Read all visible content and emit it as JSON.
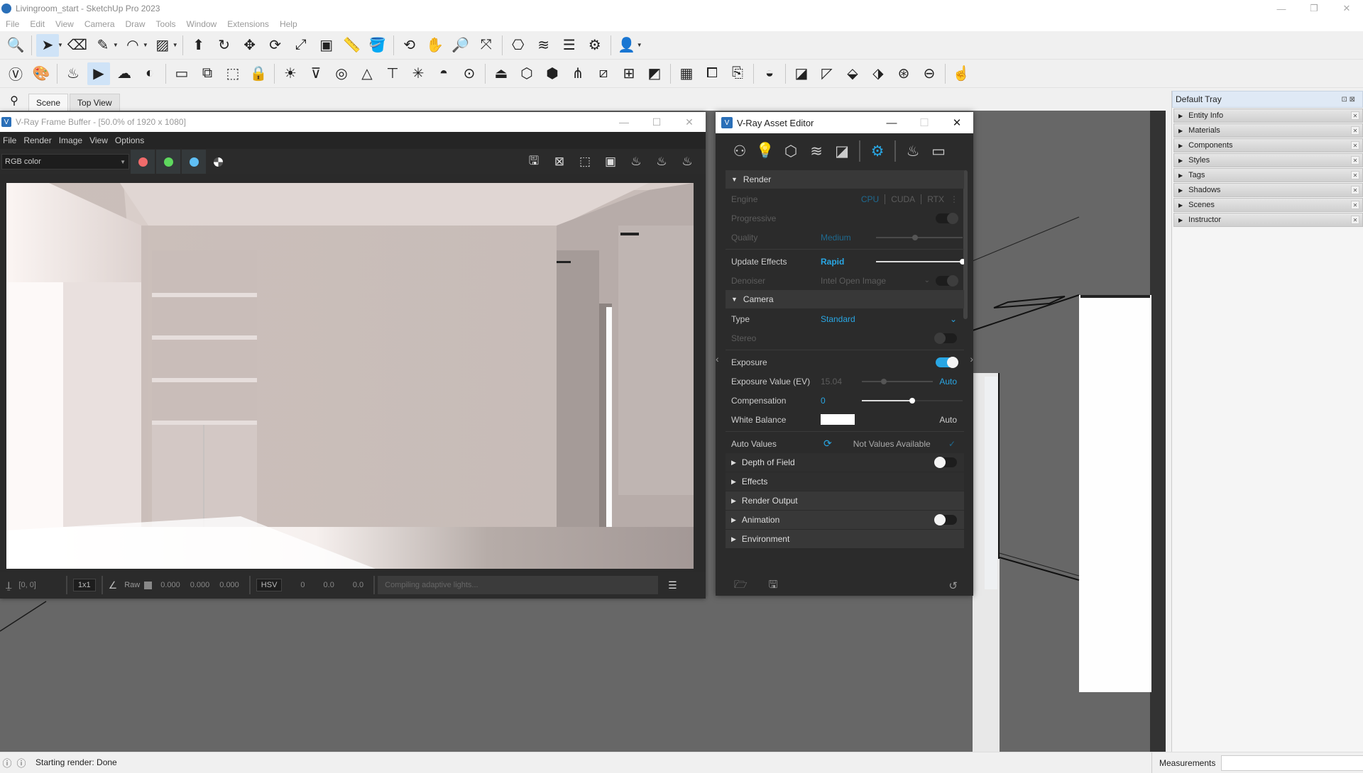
{
  "app": {
    "title": "Livingroom_start - SketchUp Pro 2023",
    "window_controls": [
      "—",
      "❐",
      "✕"
    ]
  },
  "menubar": [
    "File",
    "Edit",
    "View",
    "Camera",
    "Draw",
    "Tools",
    "Window",
    "Extensions",
    "Help"
  ],
  "toolbar1": [
    {
      "icon": "zoom-icon",
      "glyph": "🔍"
    },
    {
      "icon": "select-icon",
      "glyph": "➤",
      "selected": true,
      "dropdown": true
    },
    {
      "icon": "eraser-icon",
      "glyph": "⌫"
    },
    {
      "icon": "pencil-icon",
      "glyph": "✎",
      "dropdown": true
    },
    {
      "icon": "arc-icon",
      "glyph": "◠",
      "dropdown": true
    },
    {
      "icon": "rectangle-icon",
      "glyph": "▨",
      "dropdown": true
    },
    {
      "icon": "push-pull-icon",
      "glyph": "⬆"
    },
    {
      "icon": "follow-me-icon",
      "glyph": "↻"
    },
    {
      "icon": "move-icon",
      "glyph": "✥"
    },
    {
      "icon": "rotate-icon",
      "glyph": "⟳"
    },
    {
      "icon": "scale-icon",
      "glyph": "⤢"
    },
    {
      "icon": "offset-icon",
      "glyph": "▣"
    },
    {
      "icon": "tape-measure-icon",
      "glyph": "📏"
    },
    {
      "icon": "paint-bucket-icon",
      "glyph": "🪣"
    },
    {
      "icon": "orbit-icon",
      "glyph": "⟲"
    },
    {
      "icon": "pan-icon",
      "glyph": "✋"
    },
    {
      "icon": "zoom-window-icon",
      "glyph": "🔎"
    },
    {
      "icon": "zoom-extents-icon",
      "glyph": "⤧"
    },
    {
      "icon": "warehouse-icon",
      "glyph": "⎔"
    },
    {
      "icon": "extension-warehouse-icon",
      "glyph": "≋"
    },
    {
      "icon": "layout-icon",
      "glyph": "☰"
    },
    {
      "icon": "extension-manager-icon",
      "glyph": "⚙"
    },
    {
      "icon": "account-icon",
      "glyph": "👤",
      "dropdown": true
    }
  ],
  "toolbar2": [
    {
      "icon": "vray-logo-icon",
      "glyph": "Ⓥ"
    },
    {
      "icon": "asset-editor-icon",
      "glyph": "🎨"
    },
    {
      "icon": "render-icon",
      "glyph": "♨"
    },
    {
      "icon": "interactive-render-icon",
      "glyph": "▶",
      "selected": true
    },
    {
      "icon": "cloud-render-icon",
      "glyph": "☁"
    },
    {
      "icon": "vision-icon",
      "glyph": "◐"
    },
    {
      "icon": "frame-buffer-icon",
      "glyph": "▭"
    },
    {
      "icon": "lightmix-icon",
      "glyph": "⧉"
    },
    {
      "icon": "render-region-icon",
      "glyph": "⬚"
    },
    {
      "icon": "lock-camera-icon",
      "glyph": "🔒"
    },
    {
      "icon": "sun-light-icon",
      "glyph": "☀"
    },
    {
      "icon": "rect-light-icon",
      "glyph": "⊽"
    },
    {
      "icon": "sphere-light-icon",
      "glyph": "◎"
    },
    {
      "icon": "spot-light-icon",
      "glyph": "△"
    },
    {
      "icon": "ies-light-icon",
      "glyph": "⊤"
    },
    {
      "icon": "omni-light-icon",
      "glyph": "✳"
    },
    {
      "icon": "dome-light-icon",
      "glyph": "◓"
    },
    {
      "icon": "mesh-light-icon",
      "glyph": "⊙"
    },
    {
      "icon": "infinite-plane-icon",
      "glyph": "⏏"
    },
    {
      "icon": "export-proxy-icon",
      "glyph": "⬡"
    },
    {
      "icon": "import-proxy-icon",
      "glyph": "⬢"
    },
    {
      "icon": "fur-icon",
      "glyph": "⋔"
    },
    {
      "icon": "clipper-icon",
      "glyph": "⧄"
    },
    {
      "icon": "mesh-clipper-icon",
      "glyph": "⊞"
    },
    {
      "icon": "decal-icon",
      "glyph": "◩"
    },
    {
      "icon": "scatter-icon",
      "glyph": "▦"
    },
    {
      "icon": "chaos-cosmos-icon",
      "glyph": "⧠"
    },
    {
      "icon": "scene-interop-icon",
      "glyph": "⎘"
    },
    {
      "icon": "uv-sphere-icon",
      "glyph": "◒"
    },
    {
      "icon": "uv-unwrap-icon",
      "glyph": "◪"
    },
    {
      "icon": "tri-planar-icon",
      "glyph": "◸"
    },
    {
      "icon": "box-map-icon",
      "glyph": "⬙"
    },
    {
      "icon": "cube-map-icon",
      "glyph": "⬗"
    },
    {
      "icon": "sphere-map-icon",
      "glyph": "⊛"
    },
    {
      "icon": "cylinder-map-icon",
      "glyph": "⊖"
    },
    {
      "icon": "object-select-icon",
      "glyph": "☝"
    }
  ],
  "scenes": {
    "search_icon": "⚲",
    "tabs": [
      {
        "label": "Scene",
        "active": true
      },
      {
        "label": "Top View",
        "active": false
      }
    ]
  },
  "vfb": {
    "title": "V-Ray Frame Buffer - [50.0% of 1920 x 1080]",
    "menu": [
      "File",
      "Render",
      "Image",
      "View",
      "Options"
    ],
    "channel": "RGB color",
    "channel_colors": [
      "#f06b6b",
      "#5ed85e",
      "#5fbff5"
    ],
    "right_tools": [
      {
        "icon": "save-image-icon",
        "glyph": "🖫"
      },
      {
        "icon": "clear-image-icon",
        "glyph": "⊠"
      },
      {
        "icon": "region-render-icon",
        "glyph": "⬚"
      },
      {
        "icon": "track-mouse-icon",
        "glyph": "▣"
      },
      {
        "icon": "render-last-icon",
        "glyph": "♨"
      },
      {
        "icon": "stop-render-icon",
        "glyph": "♨"
      },
      {
        "icon": "render-interactive-icon",
        "glyph": "♨"
      }
    ],
    "status": {
      "coords": "[0, 0]",
      "sample_size": "1x1",
      "raw_label": "Raw",
      "raw_values": [
        "0.000",
        "0.000",
        "0.000"
      ],
      "color_mode": "HSV",
      "hsv_values": [
        "0",
        "0.0",
        "0.0"
      ],
      "progress_text": "Compiling adaptive lights..."
    }
  },
  "asset_editor": {
    "title": "V-Ray Asset Editor",
    "tabs": [
      {
        "icon": "materials-icon",
        "glyph": "⚇"
      },
      {
        "icon": "lights-icon",
        "glyph": "💡"
      },
      {
        "icon": "geometry-icon",
        "glyph": "⬡"
      },
      {
        "icon": "render-elements-icon",
        "glyph": "≋"
      },
      {
        "icon": "textures-icon",
        "glyph": "◪"
      },
      {
        "icon": "settings-icon",
        "glyph": "⚙",
        "active": true
      },
      {
        "icon": "render-teapot-icon",
        "glyph": "♨"
      },
      {
        "icon": "frame-buffer-icon",
        "glyph": "▭"
      }
    ],
    "render": {
      "header": "Render",
      "engine_label": "Engine",
      "engine_options": [
        "CPU",
        "CUDA",
        "RTX"
      ],
      "engine_selected": "CPU",
      "progressive_label": "Progressive",
      "quality_label": "Quality",
      "quality_value": "Medium",
      "quality_level": 0.45,
      "update_effects_label": "Update Effects",
      "update_effects_value": "Rapid",
      "update_effects_level": 1.0,
      "denoiser_label": "Denoiser",
      "denoiser_value": "Intel Open Image"
    },
    "camera": {
      "header": "Camera",
      "type_label": "Type",
      "type_value": "Standard",
      "stereo_label": "Stereo",
      "exposure_label": "Exposure",
      "exposure_on": true,
      "ev_label": "Exposure Value (EV)",
      "ev_value": "15.04",
      "ev_auto": "Auto",
      "compensation_label": "Compensation",
      "compensation_value": "0",
      "compensation_level": 0.5,
      "white_balance_label": "White Balance",
      "white_balance_color": "#ffffff",
      "white_balance_auto": "Auto",
      "auto_values_label": "Auto Values",
      "auto_values_text": "Not Values Available"
    },
    "sections": [
      {
        "label": "Depth of Field",
        "toggle": "off"
      },
      {
        "label": "Effects"
      },
      {
        "label": "Render Output"
      },
      {
        "label": "Animation",
        "toggle": "off"
      },
      {
        "label": "Environment"
      }
    ]
  },
  "tray": {
    "title": "Default Tray",
    "items": [
      "Entity Info",
      "Materials",
      "Components",
      "Styles",
      "Tags",
      "Shadows",
      "Scenes",
      "Instructor"
    ]
  },
  "statusbar": {
    "text": "Starting render: Done",
    "measurements_label": "Measurements",
    "measurements_value": ""
  }
}
